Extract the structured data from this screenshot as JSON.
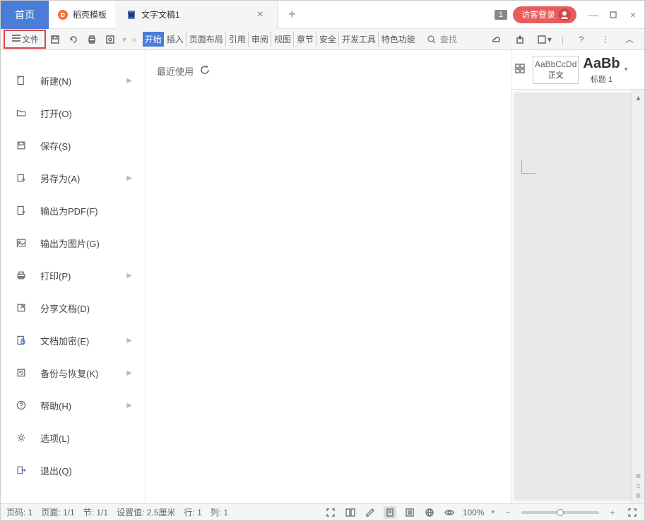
{
  "tabs": {
    "home": "首页",
    "template": "稻壳模板",
    "doc": "文字文稿1"
  },
  "login": "访客登录",
  "file_label": "文件",
  "ribbon": [
    "开始",
    "插入",
    "页面布局",
    "引用",
    "审阅",
    "视图",
    "章节",
    "安全",
    "开发工具",
    "特色功能"
  ],
  "search": "查找",
  "file_menu": [
    {
      "label": "新建(N)",
      "arrow": true
    },
    {
      "label": "打开(O)",
      "arrow": false
    },
    {
      "label": "保存(S)",
      "arrow": false
    },
    {
      "label": "另存为(A)",
      "arrow": true
    },
    {
      "label": "输出为PDF(F)",
      "arrow": false
    },
    {
      "label": "输出为图片(G)",
      "arrow": false
    },
    {
      "label": "打印(P)",
      "arrow": true
    },
    {
      "label": "分享文档(D)",
      "arrow": false
    },
    {
      "label": "文档加密(E)",
      "arrow": true
    },
    {
      "label": "备份与恢复(K)",
      "arrow": true
    },
    {
      "label": "帮助(H)",
      "arrow": true
    },
    {
      "label": "选项(L)",
      "arrow": false
    },
    {
      "label": "退出(Q)",
      "arrow": false
    }
  ],
  "recent": "最近使用",
  "styles": {
    "body": "AaBbCcDd",
    "body_label": "正文",
    "h1": "AaBb",
    "h1_label": "标题 1"
  },
  "status": {
    "page_num": "页码: 1",
    "page": "页面: 1/1",
    "section": "节: 1/1",
    "setting": "设置值: 2.5厘米",
    "row": "行: 1",
    "col": "列: 1",
    "zoom": "100%"
  },
  "badge": "1"
}
